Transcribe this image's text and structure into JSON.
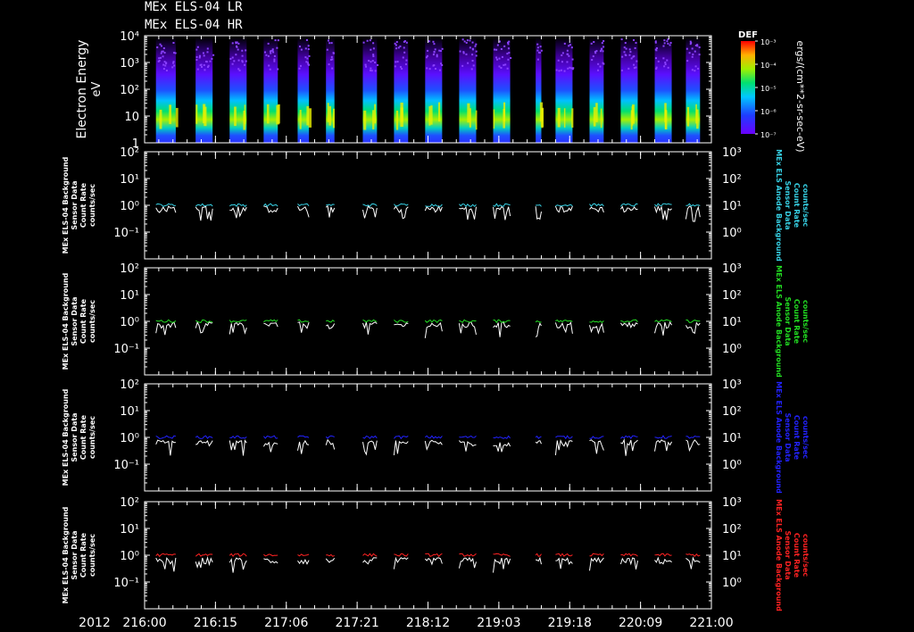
{
  "header": {
    "title_line1": "MEx ELS-04 LR",
    "title_line2": "MEx ELS-04 HR"
  },
  "colorbar": {
    "label": "DEF",
    "tick_labels": [
      "10⁻³",
      "10⁻⁴",
      "10⁻⁵",
      "10⁻⁶",
      "10⁻⁷"
    ],
    "unit_label": "ergs/(cm**2-sr-sec-eV)"
  },
  "x_axis": {
    "year_label": "2012",
    "tick_labels": [
      "216:00",
      "216:15",
      "217:06",
      "217:21",
      "218:12",
      "219:03",
      "219:18",
      "220:09",
      "221:00"
    ]
  },
  "chart_data": [
    {
      "type": "heatmap",
      "ylabel": "Electron Energy",
      "yunit": "eV",
      "yscale": "log",
      "ylim": [
        1,
        10000
      ],
      "y_tick_labels": [
        "10⁴",
        "10³",
        "10²",
        "10",
        "1"
      ],
      "colormap": "rainbow",
      "color_range": [
        1e-07,
        0.001
      ],
      "data_segments_x_fraction": [
        [
          0.02,
          0.055
        ],
        [
          0.09,
          0.12
        ],
        [
          0.15,
          0.18
        ],
        [
          0.21,
          0.235
        ],
        [
          0.27,
          0.29
        ],
        [
          0.32,
          0.335
        ],
        [
          0.385,
          0.41
        ],
        [
          0.44,
          0.465
        ],
        [
          0.495,
          0.525
        ],
        [
          0.555,
          0.585
        ],
        [
          0.615,
          0.645
        ],
        [
          0.69,
          0.7
        ],
        [
          0.725,
          0.755
        ],
        [
          0.785,
          0.81
        ],
        [
          0.84,
          0.87
        ],
        [
          0.9,
          0.93
        ],
        [
          0.955,
          0.98
        ],
        [
          1.0,
          1.0
        ]
      ]
    },
    {
      "type": "line",
      "ylabel_left": [
        "MEx ELS-04 Background",
        "Sensor Data",
        "Count Rate",
        "counts/sec"
      ],
      "ylabel_right": [
        "MEx ELS Anode Background",
        "Sensor Data",
        "Count Rate",
        "counts/sec"
      ],
      "yscale": "log",
      "ylim_left": [
        0.01,
        100
      ],
      "ylim_right": [
        0.1,
        1000
      ],
      "y_tick_labels_left": [
        "10²",
        "10¹",
        "10⁰",
        "10⁻¹"
      ],
      "y_tick_labels_right": [
        "10³",
        "10²",
        "10¹",
        "10⁰"
      ],
      "series": [
        {
          "color": "#ffffff",
          "typical_value": 0.7
        },
        {
          "color": "#37d2e6",
          "typical_value": 1.0
        }
      ]
    },
    {
      "type": "line",
      "ylabel_left": [
        "MEx ELS-04 Background",
        "Sensor Data",
        "Count Rate",
        "counts/sec"
      ],
      "ylabel_right": [
        "MEx ELS Anode Background",
        "Sensor Data",
        "Count Rate",
        "counts/sec"
      ],
      "yscale": "log",
      "ylim_left": [
        0.01,
        100
      ],
      "ylim_right": [
        0.1,
        1000
      ],
      "y_tick_labels_left": [
        "10²",
        "10¹",
        "10⁰",
        "10⁻¹"
      ],
      "y_tick_labels_right": [
        "10³",
        "10²",
        "10¹",
        "10⁰"
      ],
      "series": [
        {
          "color": "#ffffff",
          "typical_value": 0.7
        },
        {
          "color": "#22dd22",
          "typical_value": 1.0
        }
      ]
    },
    {
      "type": "line",
      "ylabel_left": [
        "MEx ELS-04 Background",
        "Sensor Data",
        "Count Rate",
        "counts/sec"
      ],
      "ylabel_right": [
        "MEx ELS Anode Background",
        "Sensor Data",
        "Count Rate",
        "counts/sec"
      ],
      "yscale": "log",
      "ylim_left": [
        0.01,
        100
      ],
      "ylim_right": [
        0.1,
        1000
      ],
      "y_tick_labels_left": [
        "10²",
        "10¹",
        "10⁰",
        "10⁻¹"
      ],
      "y_tick_labels_right": [
        "10³",
        "10²",
        "10¹",
        "10⁰"
      ],
      "series": [
        {
          "color": "#ffffff",
          "typical_value": 0.6
        },
        {
          "color": "#2222ff",
          "typical_value": 1.0
        }
      ]
    },
    {
      "type": "line",
      "ylabel_left": [
        "MEx ELS-04 Background",
        "Sensor Data",
        "Count Rate",
        "counts/sec"
      ],
      "ylabel_right": [
        "MEx ELS Anode Background",
        "Sensor Data",
        "Count Rate",
        "counts/sec"
      ],
      "yscale": "log",
      "ylim_left": [
        0.01,
        100
      ],
      "ylim_right": [
        0.1,
        1000
      ],
      "y_tick_labels_left": [
        "10²",
        "10¹",
        "10⁰",
        "10⁻¹"
      ],
      "y_tick_labels_right": [
        "10³",
        "10²",
        "10¹",
        "10⁰"
      ],
      "series": [
        {
          "color": "#ffffff",
          "typical_value": 0.6
        },
        {
          "color": "#ff2222",
          "typical_value": 1.0
        }
      ]
    }
  ]
}
